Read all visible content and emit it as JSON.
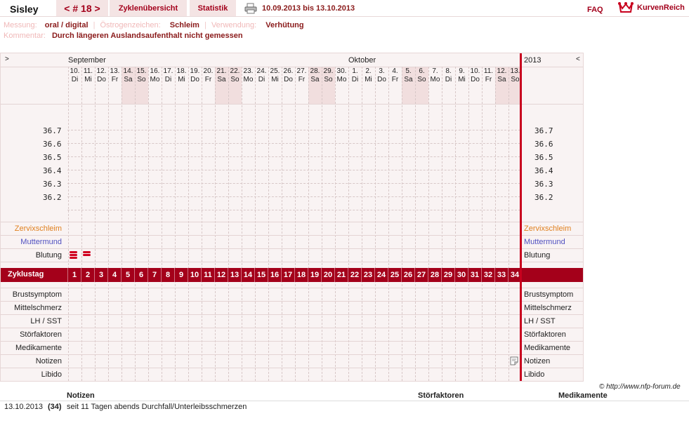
{
  "header": {
    "name": "Sisley",
    "cycle_nav": "< # 18 >",
    "tab_overview": "Zyklenübersicht",
    "tab_stats": "Statistik",
    "date_range": "10.09.2013 bis 13.10.2013",
    "faq": "FAQ",
    "brand": "KurvenReich"
  },
  "info": {
    "messung_label": "Messung:",
    "messung_value": "oral / digital",
    "oestrogen_label": "Östrogenzeichen:",
    "oestrogen_value": "Schleim",
    "verwendung_label": "Verwendung:",
    "verwendung_value": "Verhütung",
    "kommentar_label": "Kommentar:",
    "kommentar_value": "Durch längeren Auslandsaufenthalt nicht gemessen"
  },
  "chart": {
    "nav_left": ">",
    "nav_right": "<",
    "month_sep": "September",
    "month_okt": "Oktober",
    "year": "2013",
    "days": [
      {
        "d": "10.",
        "w": "Di",
        "we": false
      },
      {
        "d": "11.",
        "w": "Mi",
        "we": false
      },
      {
        "d": "12.",
        "w": "Do",
        "we": false
      },
      {
        "d": "13.",
        "w": "Fr",
        "we": false
      },
      {
        "d": "14.",
        "w": "Sa",
        "we": true
      },
      {
        "d": "15.",
        "w": "So",
        "we": true
      },
      {
        "d": "16.",
        "w": "Mo",
        "we": false
      },
      {
        "d": "17.",
        "w": "Di",
        "we": false
      },
      {
        "d": "18.",
        "w": "Mi",
        "we": false
      },
      {
        "d": "19.",
        "w": "Do",
        "we": false
      },
      {
        "d": "20.",
        "w": "Fr",
        "we": false
      },
      {
        "d": "21.",
        "w": "Sa",
        "we": true
      },
      {
        "d": "22.",
        "w": "So",
        "we": true
      },
      {
        "d": "23.",
        "w": "Mo",
        "we": false
      },
      {
        "d": "24.",
        "w": "Di",
        "we": false
      },
      {
        "d": "25.",
        "w": "Mi",
        "we": false
      },
      {
        "d": "26.",
        "w": "Do",
        "we": false
      },
      {
        "d": "27.",
        "w": "Fr",
        "we": false
      },
      {
        "d": "28.",
        "w": "Sa",
        "we": true
      },
      {
        "d": "29.",
        "w": "So",
        "we": true
      },
      {
        "d": "30.",
        "w": "Mo",
        "we": false
      },
      {
        "d": "1.",
        "w": "Di",
        "we": false
      },
      {
        "d": "2.",
        "w": "Mi",
        "we": false
      },
      {
        "d": "3.",
        "w": "Do",
        "we": false
      },
      {
        "d": "4.",
        "w": "Fr",
        "we": false
      },
      {
        "d": "5.",
        "w": "Sa",
        "we": true
      },
      {
        "d": "6.",
        "w": "So",
        "we": true
      },
      {
        "d": "7.",
        "w": "Mo",
        "we": false
      },
      {
        "d": "8.",
        "w": "Di",
        "we": false
      },
      {
        "d": "9.",
        "w": "Mi",
        "we": false
      },
      {
        "d": "10.",
        "w": "Do",
        "we": false
      },
      {
        "d": "11.",
        "w": "Fr",
        "we": false
      },
      {
        "d": "12.",
        "w": "Sa",
        "we": true
      },
      {
        "d": "13.",
        "w": "So",
        "we": true
      }
    ],
    "temps": [
      "36.7",
      "36.6",
      "36.5",
      "36.4",
      "36.3",
      "36.2"
    ],
    "labels": {
      "zervix": "Zervixschleim",
      "muttermund": "Muttermund",
      "blutung": "Blutung",
      "zyklustag": "Zyklustag",
      "brust": "Brustsymptom",
      "mittel": "Mittelschmerz",
      "lh": "LH / SST",
      "stoer": "Störfaktoren",
      "medi": "Medikamente",
      "notizen": "Notizen",
      "libido": "Libido"
    },
    "cycle_days": [
      "1",
      "2",
      "3",
      "4",
      "5",
      "6",
      "7",
      "8",
      "9",
      "10",
      "11",
      "12",
      "13",
      "14",
      "15",
      "16",
      "17",
      "18",
      "19",
      "20",
      "21",
      "22",
      "23",
      "24",
      "25",
      "26",
      "27",
      "28",
      "29",
      "30",
      "31",
      "32",
      "33",
      "34"
    ],
    "colors": {
      "accent": "#a4001a",
      "zervix": "#e08020",
      "muttermund": "#5050c0",
      "weekend": "#f1dede"
    }
  },
  "footer": {
    "copyright": "© http://www.nfp-forum.de",
    "col_notizen": "Notizen",
    "col_stoer": "Störfaktoren",
    "col_medi": "Medikamente",
    "row_date": "13.10.2013",
    "row_day": "(34)",
    "row_text": "seit 11 Tagen abends Durchfall/Unterleibsschmerzen"
  }
}
